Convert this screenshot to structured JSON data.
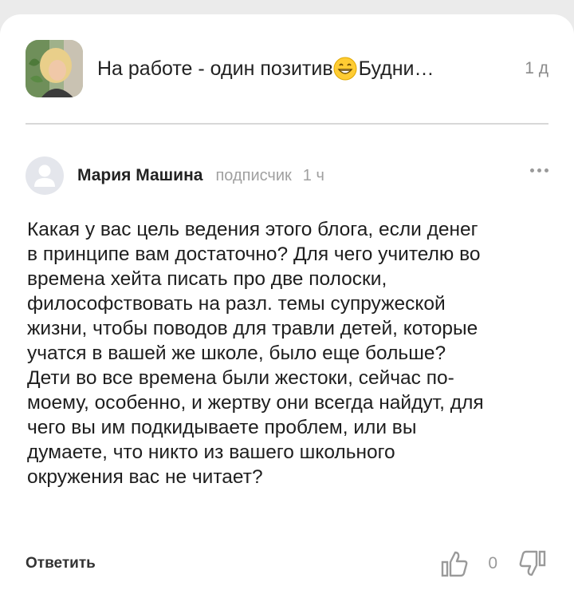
{
  "post": {
    "title": "На работе - один позитив",
    "title_suffix": "Будни…",
    "time": "1 д",
    "emoji_icon": "grinning-face-emoji"
  },
  "comment": {
    "author": "Мария Машина",
    "badge": "подписчик",
    "time": "1 ч",
    "text": "Какая у вас цель ведения этого блога, если денег\nв принципе вам достаточно? Для чего учителю во\nвремена хейта писать про две полоски,\nфилософствовать на разл. темы супружеской\nжизни, чтобы поводов для травли детей, которые\nучатся в вашей же школе, было еще больше?\nДети во все времена были жестоки, сейчас по-\nмоему, особенно, и жертву они всегда найдут, для\nчего вы им подкидываете проблем, или вы\nдумаете, что никто из вашего школьного\nокружения вас не читает?",
    "reply_label": "Ответить",
    "score": "0"
  },
  "icons": {
    "more": "more-horizontal-icon",
    "like": "thumb-up-icon",
    "dislike": "thumb-down-icon",
    "avatar": "default-user-avatar"
  },
  "colors": {
    "background": "#ebebeb",
    "card": "#ffffff",
    "text": "#1e1e1e",
    "muted": "#a0a0a0",
    "avatar_bg": "#e4e6ec"
  }
}
